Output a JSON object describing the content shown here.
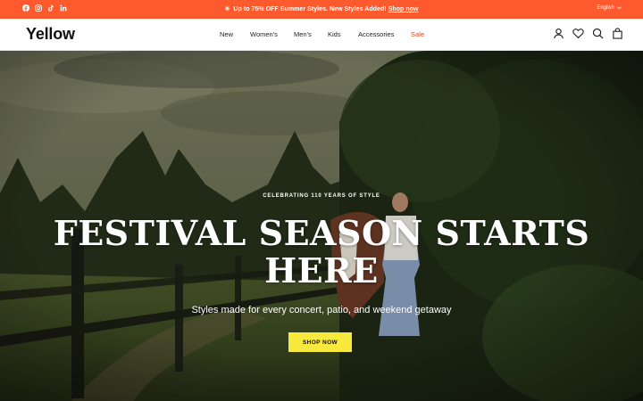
{
  "announcement": {
    "sparkle": "✳",
    "text": "Up to 75% OFF Summer Styles. New Styles Added!",
    "link": "Shop now",
    "language": "English"
  },
  "socials": [
    "facebook-icon",
    "instagram-icon",
    "tiktok-icon",
    "linkedin-icon"
  ],
  "header": {
    "logo": "Yellow",
    "nav": [
      "New",
      "Women's",
      "Men's",
      "Kids",
      "Accessories",
      "Sale"
    ],
    "icons": [
      "account-icon",
      "wishlist-icon",
      "search-icon",
      "cart-icon"
    ]
  },
  "hero": {
    "eyebrow": "CELEBRATING 110 YEARS OF STYLE",
    "headline": "FESTIVAL SEASON STARTS HERE",
    "subline": "Styles made for every concert, patio, and weekend getaway",
    "cta": "SHOP NOW"
  },
  "colors": {
    "announce_bg": "#ff5a2e",
    "sale": "#e5401c",
    "cta_bg": "#f7e93d"
  }
}
